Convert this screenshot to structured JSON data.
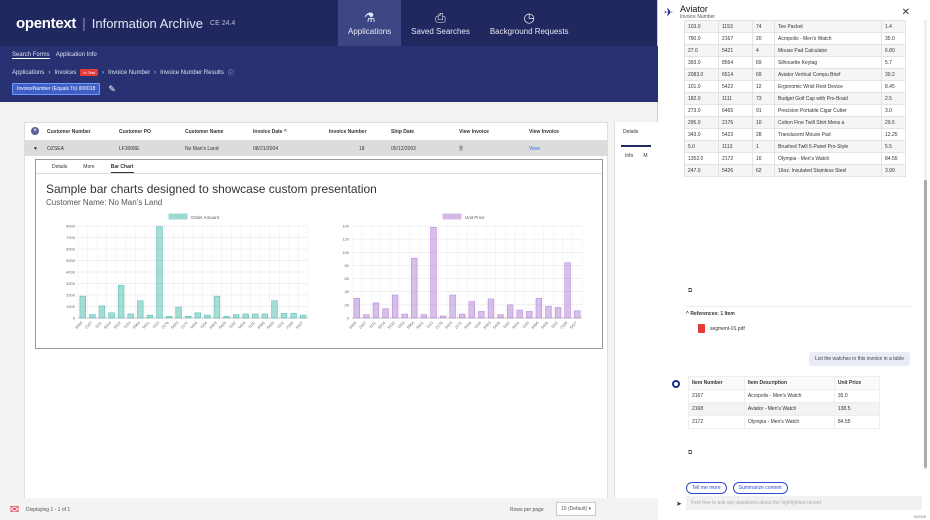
{
  "app": {
    "logo": "opentext",
    "product": "Information Archive",
    "version": "CE 24.4"
  },
  "nav": [
    {
      "label": "Applications",
      "icon": "applications-icon"
    },
    {
      "label": "Saved Searches",
      "icon": "saved-searches-icon"
    },
    {
      "label": "Background Requests",
      "icon": "clock-icon"
    }
  ],
  "subnav": {
    "tabs": [
      "Search Forms",
      "Application Info"
    ],
    "breadcrumb": [
      "Applications",
      "Invoices",
      "Invoice Number",
      "Invoice Number Results"
    ],
    "breadcrumb_badge": "In Test",
    "filter": "InvoiceNumber (Equals To) 000018"
  },
  "grid": {
    "headers": [
      "Customer Number",
      "Customer PO",
      "Customer Name",
      "Invoice Date ^",
      "Invoice Number",
      "Ship Date",
      "View Invoice",
      "View Invoice"
    ],
    "row": [
      "OZSEA",
      "LF3008E",
      "No Man's Land",
      "08/21/2004",
      "18",
      "05/12/2002",
      "View"
    ],
    "detail_tabs": [
      "Details",
      "More",
      "Bar Chart"
    ]
  },
  "chart_panel": {
    "title": "Sample bar charts designed to showcase custom presentation",
    "subtitle": "Customer Name: No Man's Land"
  },
  "chart_data": [
    {
      "type": "bar",
      "title": "",
      "legend": "Order Amount",
      "categories": [
        "6465",
        "2167",
        "1111",
        "6514",
        "5422",
        "1153",
        "8564",
        "5421",
        "1113",
        "2176",
        "5423",
        "2172",
        "5426",
        "1154",
        "6463",
        "5425",
        "1152",
        "5424",
        "1110",
        "6466",
        "5420",
        "1112",
        "2168",
        "5427"
      ],
      "values": [
        1900,
        300,
        1050,
        450,
        2850,
        350,
        1500,
        250,
        7950,
        150,
        950,
        150,
        450,
        250,
        1900,
        150,
        300,
        350,
        350,
        350,
        1500,
        400,
        400,
        250
      ],
      "ylim": [
        0,
        8000
      ],
      "yticks": [
        0,
        1000,
        2000,
        3000,
        4000,
        5000,
        6000,
        7000,
        8000
      ],
      "color": "#5bc0b5"
    },
    {
      "type": "bar",
      "title": "",
      "legend": "Unit Price",
      "categories": [
        "6465",
        "2167",
        "1111",
        "6514",
        "5422",
        "1153",
        "8564",
        "5421",
        "1113",
        "2176",
        "5423",
        "2172",
        "5426",
        "1154",
        "6463",
        "5425",
        "1152",
        "5424",
        "1110",
        "6466",
        "5420",
        "1112",
        "2168",
        "5427"
      ],
      "values": [
        30,
        5,
        23,
        14,
        35,
        6,
        91,
        5,
        138,
        3,
        35,
        6,
        25,
        10,
        29,
        5,
        20,
        12,
        10,
        30,
        18,
        16,
        84,
        11
      ],
      "ylim": [
        0,
        140
      ],
      "yticks": [
        0,
        20,
        40,
        60,
        80,
        100,
        120,
        140
      ],
      "color": "#b78ad9"
    }
  ],
  "right_panel": {
    "tab": "Details",
    "subtabs": [
      "Info",
      "M"
    ]
  },
  "footer": {
    "displaying": "Displaying 1 - 1 of 1",
    "rows_per_page_label": "Rows per page",
    "rows_per_page_value": "10 (Default)"
  },
  "aviator": {
    "title": "Aviator",
    "subtitle": "Invoice Number",
    "table_rows": [
      [
        "103.0",
        "1153",
        "74",
        "Tee Packet",
        "1.4"
      ],
      [
        "790.0",
        "2167",
        "20",
        "Acropolis - Men's Watch",
        "35.0"
      ],
      [
        "27.0",
        "5421",
        "4",
        "Mouse Pad Calculator",
        "6.80"
      ],
      [
        "393.0",
        "8564",
        "69",
        "Silhouette Keytag",
        "5.7"
      ],
      [
        "2083.0",
        "6514",
        "69",
        "Aviator Vertical Compu Brief",
        "30.2"
      ],
      [
        "101.0",
        "5422",
        "12",
        "Ergonomic Wrist Rest Device",
        "8.45"
      ],
      [
        "182.0",
        "1111",
        "73",
        "Budget Golf Cap with Pro-Braid",
        "2.5"
      ],
      [
        "273.0",
        "6465",
        "91",
        "Precision Portable Cigar Cutter",
        "3.0"
      ],
      [
        "295.0",
        "2176",
        "10",
        "Cotton Fine Twill Shirt Mens a",
        "29.5"
      ],
      [
        "343.0",
        "5423",
        "28",
        "Translucent Mouse Pad",
        "12.25"
      ],
      [
        "5.0",
        "1113",
        "1",
        "Brushed Twill 5-Panel Pro-Style",
        "5.5"
      ],
      [
        "1352.0",
        "2172",
        "16",
        "Olympia - Men's Watch",
        "84.55"
      ],
      [
        "247.0",
        "5426",
        "62",
        "16oz. Insulated Stainless Steel",
        "3.99"
      ]
    ],
    "references_label": "References: 1 Item",
    "reference_file": "segment-01.pdf",
    "user_message": "List the watches in this invoice in a table",
    "items_headers": [
      "Item Number",
      "Item Description",
      "Unit Price"
    ],
    "items_rows": [
      [
        "2167",
        "Acropolis - Men's Watch",
        "35.0"
      ],
      [
        "2168",
        "Aviator - Men's Watch",
        "138.5"
      ],
      [
        "2172",
        "Olympia - Men's Watch",
        "84.55"
      ]
    ],
    "prompts": [
      "Tell me more",
      "Summarize content"
    ],
    "input_placeholder": "Feel free to ask any questions about the highlighted record",
    "char_count": "0/2000"
  }
}
